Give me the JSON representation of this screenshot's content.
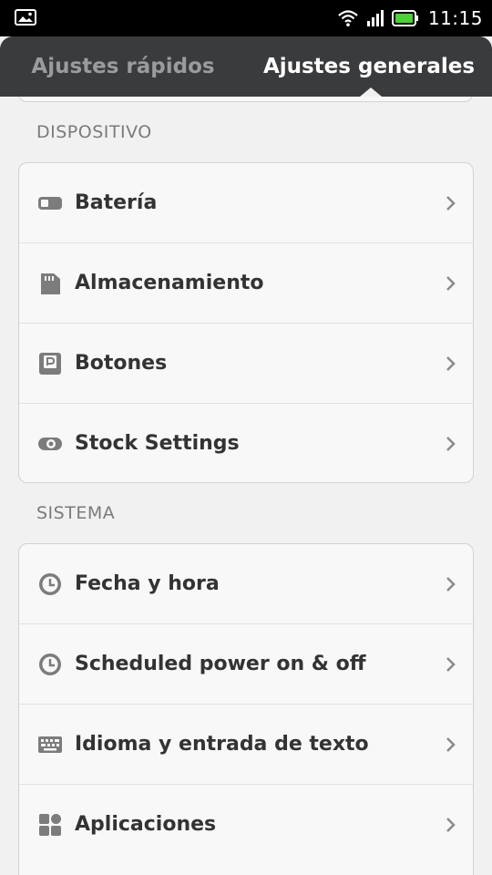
{
  "status_bar": {
    "time": "11:15",
    "icons": [
      "image-notification-icon",
      "wifi-icon",
      "signal-icon",
      "battery-icon"
    ],
    "battery_color": "#4cd137"
  },
  "tabs": [
    {
      "label": "Ajustes rápidos",
      "active": false
    },
    {
      "label": "Ajustes generales",
      "active": true
    }
  ],
  "sections": [
    {
      "title": "DISPOSITIVO",
      "items": [
        {
          "label": "Batería",
          "icon": "battery-setting-icon"
        },
        {
          "label": "Almacenamiento",
          "icon": "sd-card-icon"
        },
        {
          "label": "Botones",
          "icon": "buttons-icon"
        },
        {
          "label": "Stock Settings",
          "icon": "eye-toggle-icon"
        }
      ]
    },
    {
      "title": "SISTEMA",
      "items": [
        {
          "label": "Fecha y hora",
          "icon": "clock-icon"
        },
        {
          "label": "Scheduled power on & off",
          "icon": "clock-icon"
        },
        {
          "label": "Idioma y entrada de texto",
          "icon": "keyboard-icon"
        },
        {
          "label": "Aplicaciones",
          "icon": "apps-icon"
        }
      ]
    }
  ],
  "colors": {
    "header_bg": "#3a3b3d",
    "page_bg": "#f1f1f1",
    "card_bg": "#f8f8f8",
    "label_text": "#333333",
    "icon_gray": "#7c7c7c"
  }
}
